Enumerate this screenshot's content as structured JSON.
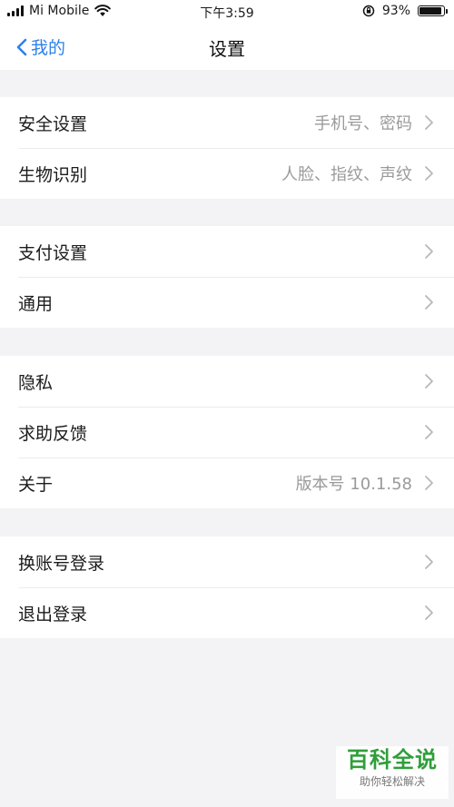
{
  "status_bar": {
    "carrier": "Mi Mobile",
    "time": "下午3:59",
    "battery_percent": "93%",
    "battery_level": 0.93
  },
  "nav": {
    "back_label": "我的",
    "title": "设置"
  },
  "groups": [
    {
      "items": [
        {
          "label": "安全设置",
          "value": "手机号、密码"
        },
        {
          "label": "生物识别",
          "value": "人脸、指纹、声纹"
        }
      ]
    },
    {
      "items": [
        {
          "label": "支付设置",
          "value": ""
        },
        {
          "label": "通用",
          "value": ""
        }
      ]
    },
    {
      "items": [
        {
          "label": "隐私",
          "value": ""
        },
        {
          "label": "求助反馈",
          "value": ""
        },
        {
          "label": "关于",
          "value": "版本号 10.1.58"
        }
      ]
    },
    {
      "items": [
        {
          "label": "换账号登录",
          "value": ""
        },
        {
          "label": "退出登录",
          "value": ""
        }
      ]
    }
  ],
  "watermark": {
    "title": "百科全说",
    "subtitle": "助你轻松解决"
  },
  "colors": {
    "accent": "#2f80ed",
    "background": "#f3f3f5",
    "secondary_text": "#9a9a9a",
    "watermark_green": "#2f9e3a"
  }
}
